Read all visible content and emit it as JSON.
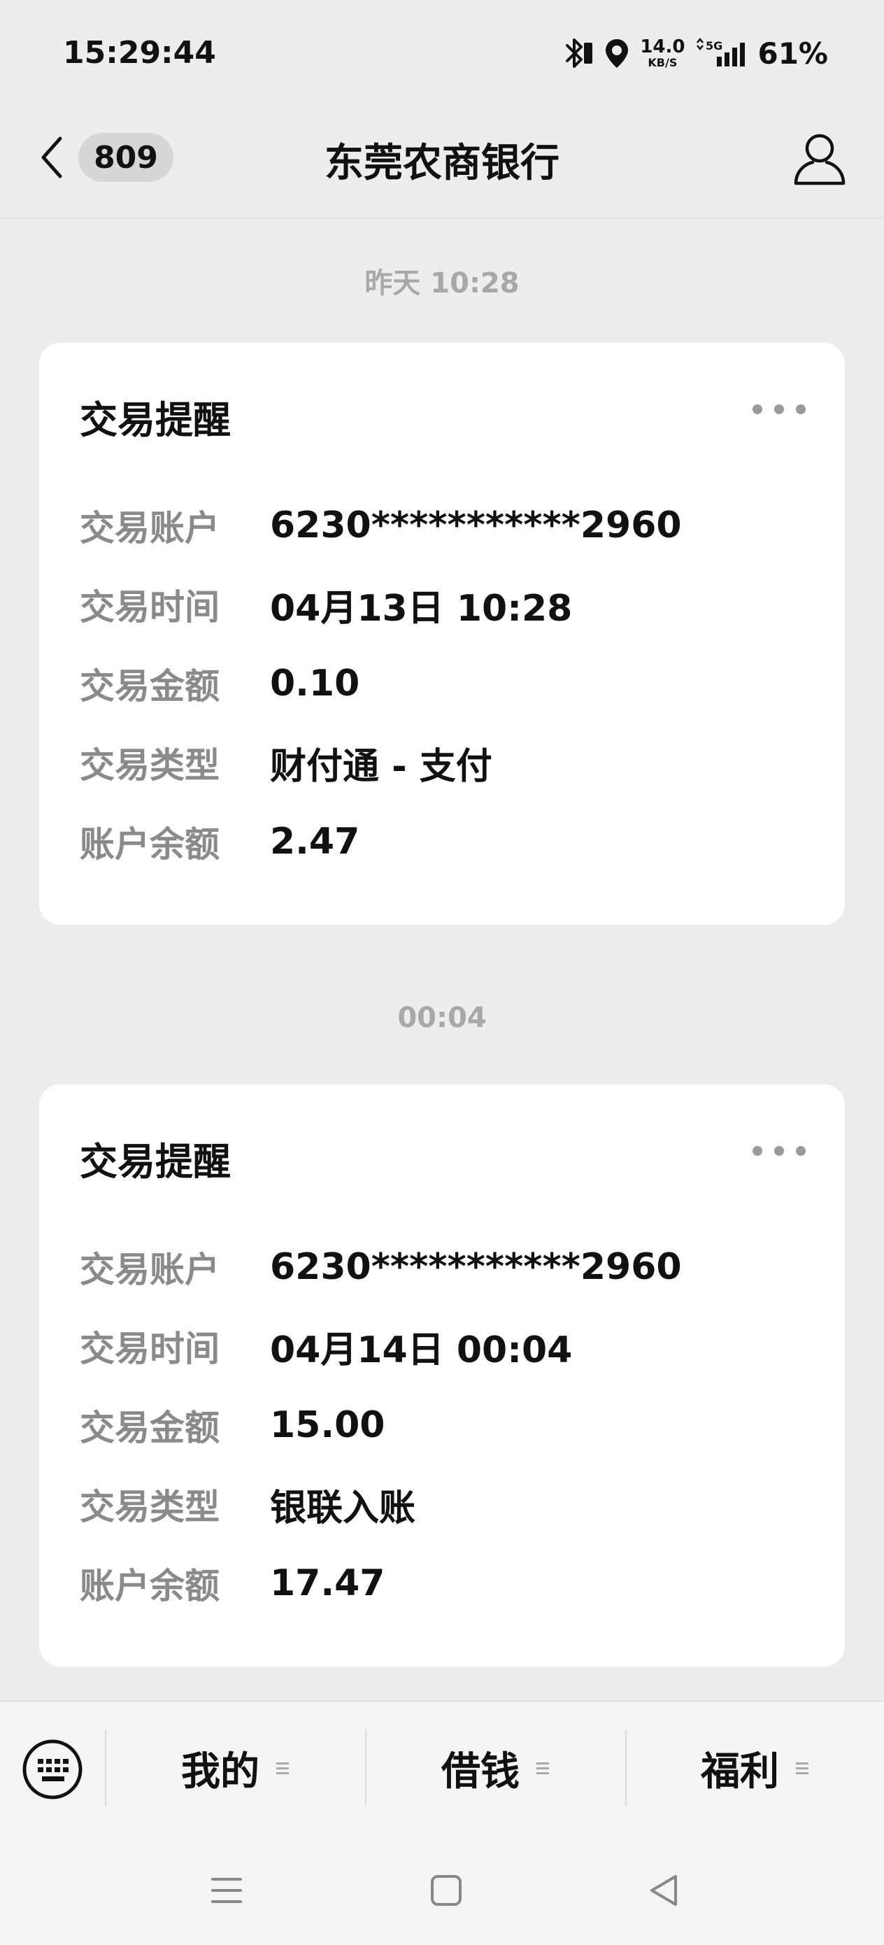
{
  "status_bar": {
    "time": "15:29:44",
    "net_speed_value": "14.0",
    "net_speed_unit": "KB/S",
    "network": "5G",
    "battery": "61%"
  },
  "header": {
    "unread_count": "809",
    "title": "东莞农商银行"
  },
  "messages": [
    {
      "time_label": "昨天 10:28",
      "title": "交易提醒",
      "rows": [
        {
          "label": "交易账户",
          "value": "6230***********2960"
        },
        {
          "label": "交易时间",
          "value": "04月13日 10:28"
        },
        {
          "label": "交易金额",
          "value": "0.10"
        },
        {
          "label": "交易类型",
          "value": "财付通 - 支付"
        },
        {
          "label": "账户余额",
          "value": "2.47"
        }
      ]
    },
    {
      "time_label": "00:04",
      "title": "交易提醒",
      "rows": [
        {
          "label": "交易账户",
          "value": "6230***********2960"
        },
        {
          "label": "交易时间",
          "value": "04月14日 00:04"
        },
        {
          "label": "交易金额",
          "value": "15.00"
        },
        {
          "label": "交易类型",
          "value": "银联入账"
        },
        {
          "label": "账户余额",
          "value": "17.47"
        }
      ]
    }
  ],
  "menu": {
    "items": [
      {
        "label": "我的"
      },
      {
        "label": "借钱"
      },
      {
        "label": "福利"
      }
    ]
  },
  "icons": {
    "bluetooth": "bluetooth-icon",
    "location": "location-icon",
    "signal": "signal-icon",
    "back": "chevron-left-icon",
    "profile": "person-icon",
    "more": "more-dots-icon",
    "keyboard": "keyboard-icon",
    "menu_indicator": "hamburger-icon"
  },
  "colors": {
    "background": "#ededed",
    "card": "#ffffff",
    "label_gray": "#8a8a8a",
    "time_gray": "#a8a8a8"
  }
}
